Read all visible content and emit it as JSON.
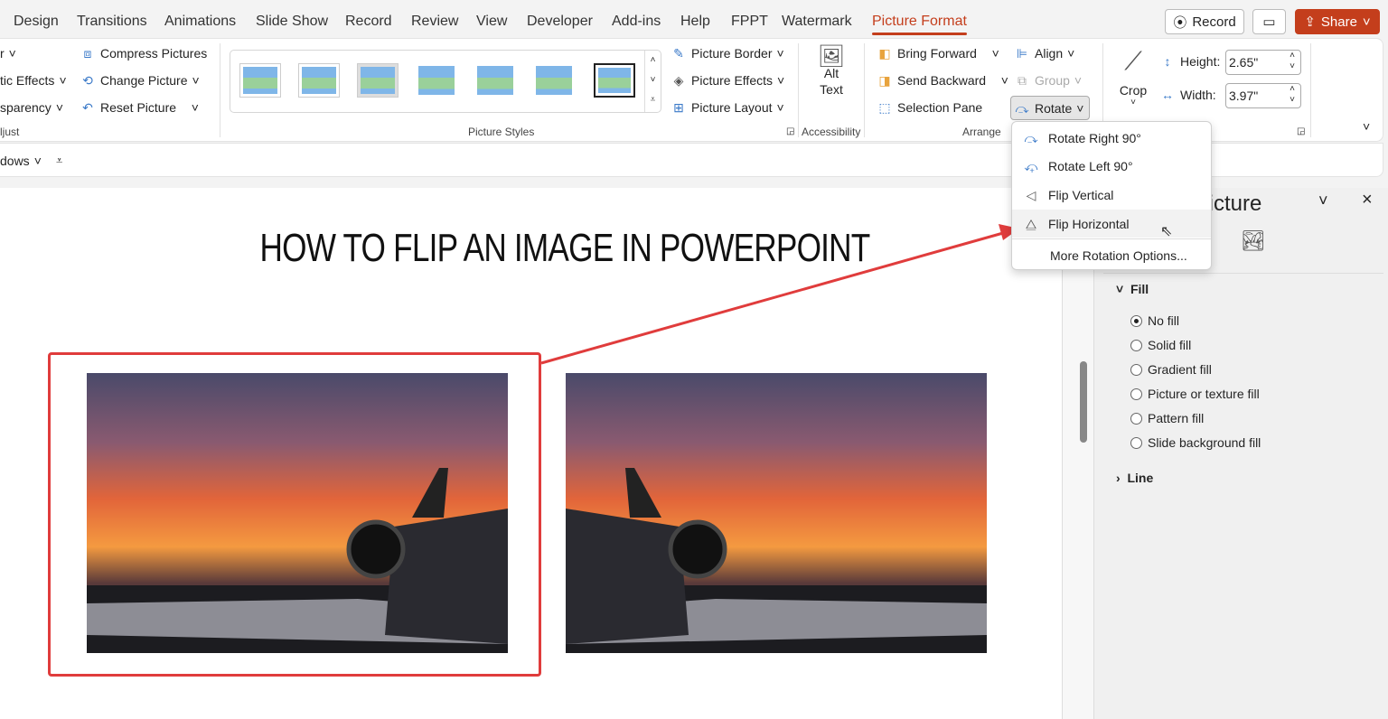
{
  "tabs": [
    "Design",
    "Transitions",
    "Animations",
    "Slide Show",
    "Record",
    "Review",
    "View",
    "Developer",
    "Add-ins",
    "Help",
    "FPPT",
    "Watermark",
    "Picture Format"
  ],
  "active_tab": "Picture Format",
  "top_buttons": {
    "record": "Record",
    "share": "Share"
  },
  "ribbon": {
    "adjust": {
      "items": [
        "r",
        "tic Effects",
        "sparency"
      ],
      "label": "ljust"
    },
    "picture_tools": [
      "Compress Pictures",
      "Change Picture",
      "Reset Picture"
    ],
    "styles": {
      "label": "Picture Styles",
      "count": 7
    },
    "picture_options": [
      "Picture Border",
      "Picture Effects",
      "Picture Layout"
    ],
    "accessibility": {
      "button": "Alt\nText",
      "alt1": "Alt",
      "alt2": "Text",
      "label": "Accessibility"
    },
    "arrange": {
      "items": [
        "Bring Forward",
        "Send Backward",
        "Selection Pane"
      ],
      "align": "Align",
      "group": "Group",
      "rotate": "Rotate",
      "label": "Arrange"
    },
    "size": {
      "crop": "Crop",
      "height_label": "Height:",
      "height_value": "2.65\"",
      "width_label": "Width:",
      "width_value": "3.97\""
    }
  },
  "row2": {
    "windows": "dows"
  },
  "rotate_menu": [
    "Rotate Right 90°",
    "Rotate Left 90°",
    "Flip Vertical",
    "Flip Horizontal",
    "More Rotation Options..."
  ],
  "slide": {
    "title": "HOW TO FLIP AN IMAGE IN POWERPOINT"
  },
  "pane": {
    "title": "Format Picture",
    "fill": "Fill",
    "line": "Line",
    "fill_options": [
      "No fill",
      "Solid fill",
      "Gradient fill",
      "Picture or texture fill",
      "Pattern fill",
      "Slide background fill"
    ],
    "selected_fill": "No fill"
  },
  "colors": {
    "accent": "#c43e1c",
    "highlight": "#e03c3c"
  }
}
